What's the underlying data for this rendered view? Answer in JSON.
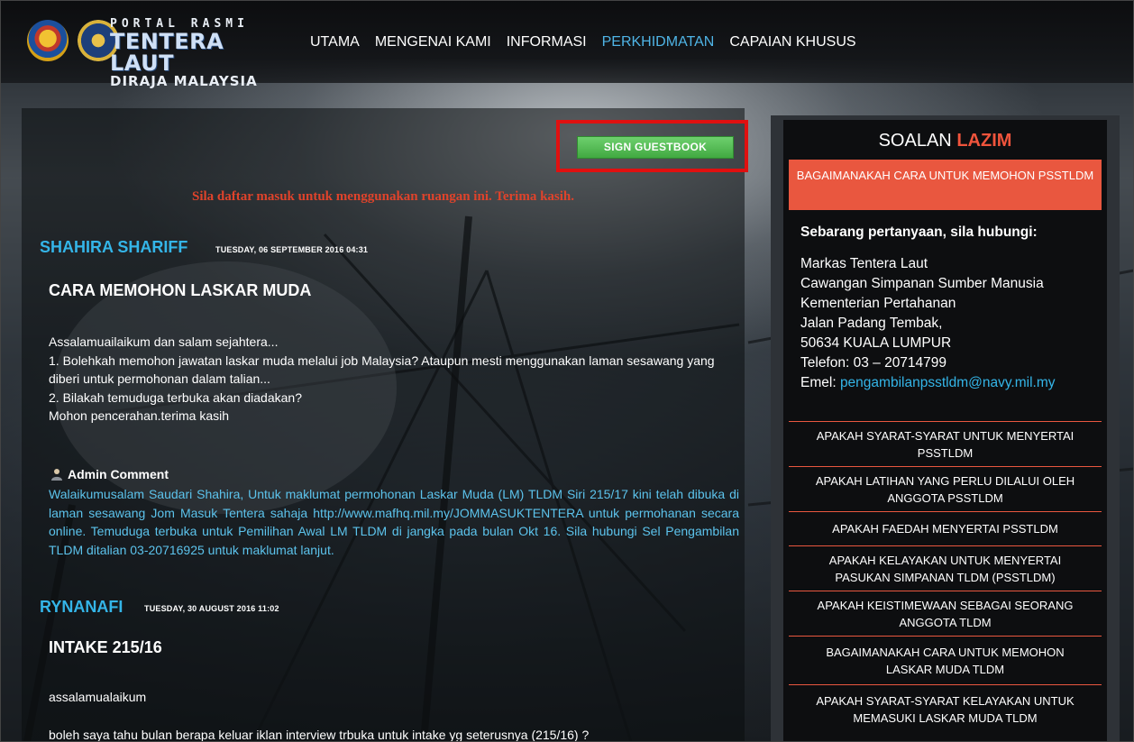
{
  "logo": {
    "line1": "PORTAL RASMI",
    "line2": "TENTERA LAUT",
    "line3": "DIRAJA MALAYSIA"
  },
  "nav": [
    {
      "label": "UTAMA",
      "active": false
    },
    {
      "label": "MENGENAI KAMI",
      "active": false
    },
    {
      "label": "INFORMASI",
      "active": false
    },
    {
      "label": "PERKHIDMATAN",
      "active": true
    },
    {
      "label": "CAPAIAN KHUSUS",
      "active": false
    }
  ],
  "guestbook": {
    "button_label": "SIGN GUESTBOOK",
    "notice": "Sila daftar masuk untuk menggunakan ruangan ini. Terima kasih."
  },
  "entries": [
    {
      "author": "SHAHIRA SHARIFF",
      "date": "TUESDAY, 06 SEPTEMBER 2016 04:31",
      "title": "CARA MEMOHON LASKAR MUDA",
      "body": [
        "Assalamuailaikum dan salam sejahtera...",
        "1. Bolehkah memohon jawatan laskar muda melalui job Malaysia? Ataupun mesti menggunakan laman sesawang yang diberi untuk permohonan dalam talian...",
        "2. Bilakah temuduga terbuka akan diadakan?",
        "Mohon pencerahan.terima kasih"
      ],
      "admin_label": "Admin Comment",
      "admin_comment": "Walaikumusalam Saudari Shahira, Untuk maklumat permohonan Laskar Muda (LM) TLDM Siri 215/17 kini telah dibuka di laman sesawang Jom Masuk Tentera sahaja http://www.mafhq.mil.my/JOMMASUKTENTERA untuk permohanan secara online. Temuduga terbuka untuk Pemilihan Awal LM TLDM di jangka pada bulan Okt 16. Sila hubungi Sel Pengambilan TLDM ditalian 03-20716925 untuk maklumat lanjut."
    },
    {
      "author": "RYNANAFI",
      "date": "TUESDAY, 30 AUGUST 2016 11:02",
      "title": "INTAKE 215/16",
      "body": [
        "assalamualaikum",
        "boleh saya tahu bulan berapa keluar iklan interview trbuka untuk intake yg seterusnya (215/16) ?"
      ]
    }
  ],
  "sidebar": {
    "title_main": "SOALAN",
    "title_accent": "LAZIM",
    "active_item": "BAGAIMANAKAH CARA UNTUK MEMOHON PSSTLDM",
    "contact": {
      "heading": "Sebarang pertanyaan, sila hubungi:",
      "lines": [
        "Markas Tentera Laut",
        "Cawangan Simpanan Sumber Manusia",
        "Kementerian Pertahanan",
        "Jalan Padang Tembak,",
        "50634 KUALA LUMPUR",
        "Telefon: 03 – 20714799"
      ],
      "email_label": "Emel:",
      "email": "pengambilanpsstldm@navy.mil.my"
    },
    "items": [
      "APAKAH SYARAT-SYARAT UNTUK MENYERTAI PSSTLDM",
      "APAKAH LATIHAN YANG PERLU DILALUI OLEH ANGGOTA PSSTLDM",
      "APAKAH FAEDAH MENYERTAI PSSTLDM",
      "APAKAH KELAYAKAN UNTUK MENYERTAI PASUKAN SIMPANAN TLDM (PSSTLDM)",
      "APAKAH KEISTIMEWAAN SEBAGAI SEORANG ANGGOTA TLDM",
      "BAGAIMANAKAH CARA UNTUK MEMOHON LASKAR MUDA TLDM",
      "APAKAH SYARAT-SYARAT KELAYAKAN UNTUK MEMASUKI LASKAR MUDA TLDM"
    ]
  },
  "colors": {
    "accent_blue": "#34b5e8",
    "accent_red": "#e9573f",
    "button_green": "#4cb84c",
    "highlight_red": "#e01010"
  }
}
